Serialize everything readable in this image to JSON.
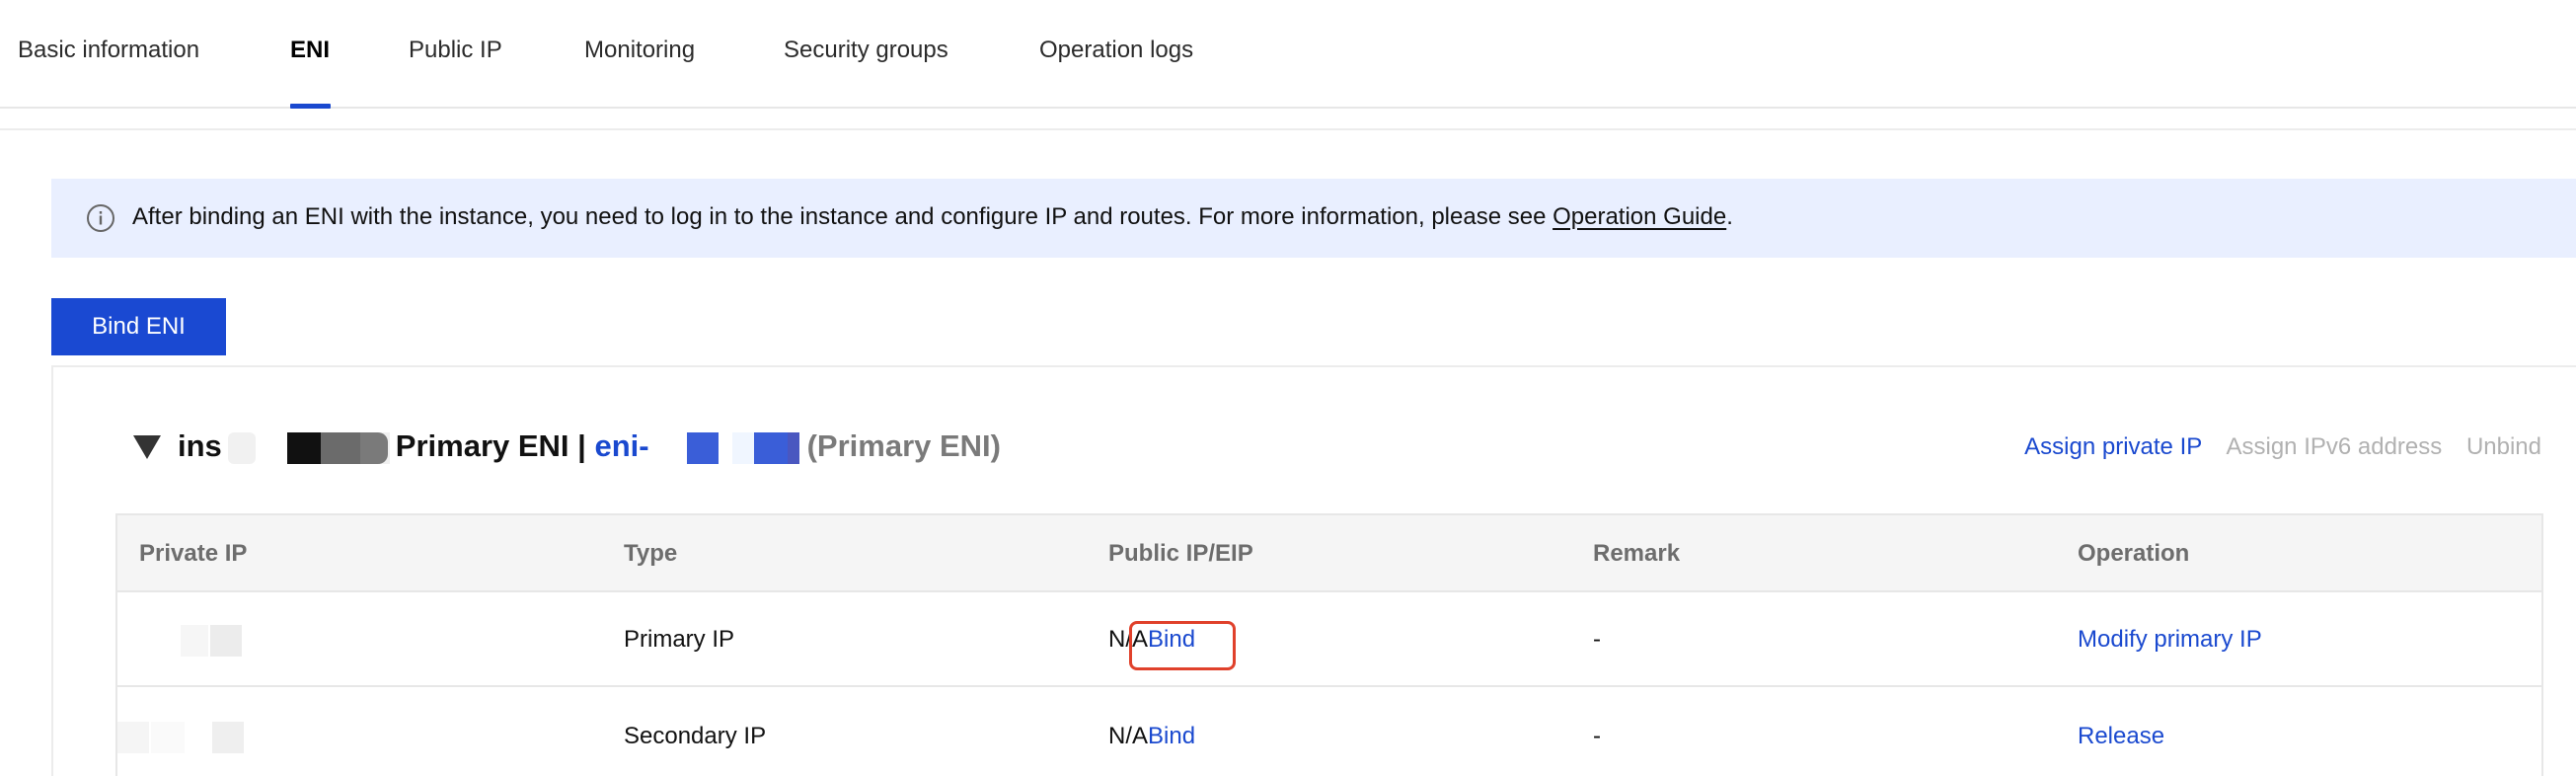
{
  "tabs": [
    {
      "label": "Basic information",
      "active": false
    },
    {
      "label": "ENI",
      "active": true
    },
    {
      "label": "Public IP",
      "active": false
    },
    {
      "label": "Monitoring",
      "active": false
    },
    {
      "label": "Security groups",
      "active": false
    },
    {
      "label": "Operation logs",
      "active": false
    }
  ],
  "banner": {
    "icon": "info-circle-icon",
    "text": "After binding an ENI with the instance, you need to log in to the instance and configure IP and routes. For more information, please see ",
    "link": "Operation Guide",
    "suffix": "."
  },
  "bind_eni_button": "Bind ENI",
  "eni_header": {
    "instance_prefix": "ins",
    "primary_label": "Primary ENI |",
    "eni_prefix": "eni-",
    "eni_suffix": "(Primary ENI)"
  },
  "actions": {
    "assign_private_ip": "Assign private IP",
    "assign_ipv6": "Assign IPv6 address",
    "unbind": "Unbind"
  },
  "table": {
    "columns": [
      "Private IP",
      "Type",
      "Public IP/EIP",
      "Remark",
      "Operation"
    ],
    "rows": [
      {
        "type": "Primary IP",
        "public_ip": "N/A",
        "bind": "Bind",
        "remark": "-",
        "operation": "Modify primary IP"
      },
      {
        "type": "Secondary IP",
        "public_ip": "N/A",
        "bind": "Bind",
        "remark": "-",
        "operation": "Release"
      }
    ]
  },
  "colors": {
    "accent": "#1a49cf",
    "banner_bg": "#e9efff",
    "highlight": "#e0412b",
    "disabled": "#b1b1b1"
  }
}
